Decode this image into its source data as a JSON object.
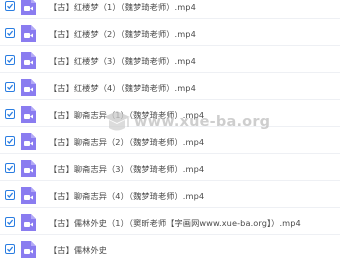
{
  "files": [
    {
      "name": "【古】红楼梦（1）（魏梦琦老师）.mp4",
      "checked": true
    },
    {
      "name": "【古】红楼梦（2）（魏梦琦老师）.mp4",
      "checked": true
    },
    {
      "name": "【古】红楼梦（3）（魏梦琦老师）.mp4",
      "checked": true
    },
    {
      "name": "【古】红楼梦（4）（魏梦琦老师）.mp4",
      "checked": true
    },
    {
      "name": "【古】聊斋志异（1）（魏梦琦老师）.mp4",
      "checked": true
    },
    {
      "name": "【古】聊斋志异（2）（魏梦琦老师）.mp4",
      "checked": true
    },
    {
      "name": "【古】聊斋志异（3）（魏梦琦老师）.mp4",
      "checked": true
    },
    {
      "name": "【古】聊斋志异（4）（魏梦琦老师）.mp4",
      "checked": true
    },
    {
      "name": "【古】儒林外史（1）（窦昕老师【字画网www.xue-ba.org】）.mp4",
      "checked": true
    },
    {
      "name": "【古】儒林外史",
      "checked": true
    }
  ],
  "watermark": {
    "text": "www.xue-ba.org"
  },
  "colors": {
    "checkbox": "#2a7de1",
    "video_icon": "#7b68ee",
    "text": "#4a4a4a"
  },
  "icons": {
    "checkbox": "checkmark-icon",
    "file": "video-file-icon"
  }
}
